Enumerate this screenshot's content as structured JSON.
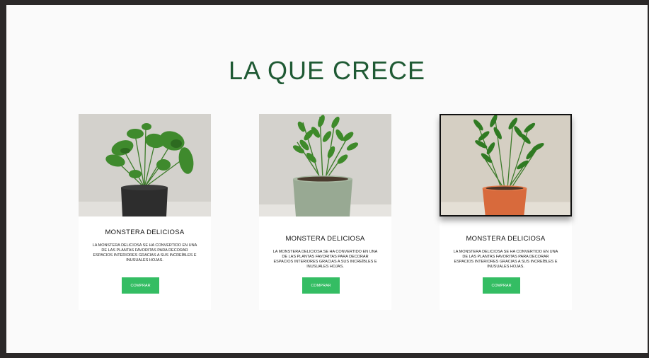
{
  "page": {
    "title": "LA QUE CRECE"
  },
  "products": [
    {
      "title": "MONSTERA DELICIOSA",
      "description": "LA MONSTERA DELICIOSA SE HA CONVERTIDO EN UNA DE LAS PLANTAS FAVORITAS PARA DECORAR ESPACIOS INTERIORES GRACIAS A SUS INCREÍBLES E INUSUALES HOJAS.",
      "button": "COMPRAR",
      "image": "monstera-in-black-pot"
    },
    {
      "title": "MONSTERA DELICIOSA",
      "description": "LA MONSTERA DELICIOSA SE HA CONVERTIDO EN UNA DE LAS PLANTAS FAVORITAS PARA DECORAR ESPACIOS INTERIORES GRACIAS A SUS INCREÍBLES E INUSUALES HOJAS.",
      "button": "COMPRAR",
      "image": "zz-plant-in-sage-pot"
    },
    {
      "title": "MONSTERA DELICIOSA",
      "description": "LA MONSTERA DELICIOSA SE HA CONVERTIDO EN UNA DE LAS PLANTAS FAVORITAS PARA DECORAR ESPACIOS INTERIORES GRACIAS A SUS INCREÍBLES E INUSUALES HOJAS.",
      "button": "COMPRAR",
      "image": "zz-plant-in-terracotta-pot",
      "selected": true
    }
  ],
  "colors": {
    "title": "#1f5a34",
    "button": "#34bd63",
    "frame": "#2b2828",
    "background": "#fafafa"
  }
}
